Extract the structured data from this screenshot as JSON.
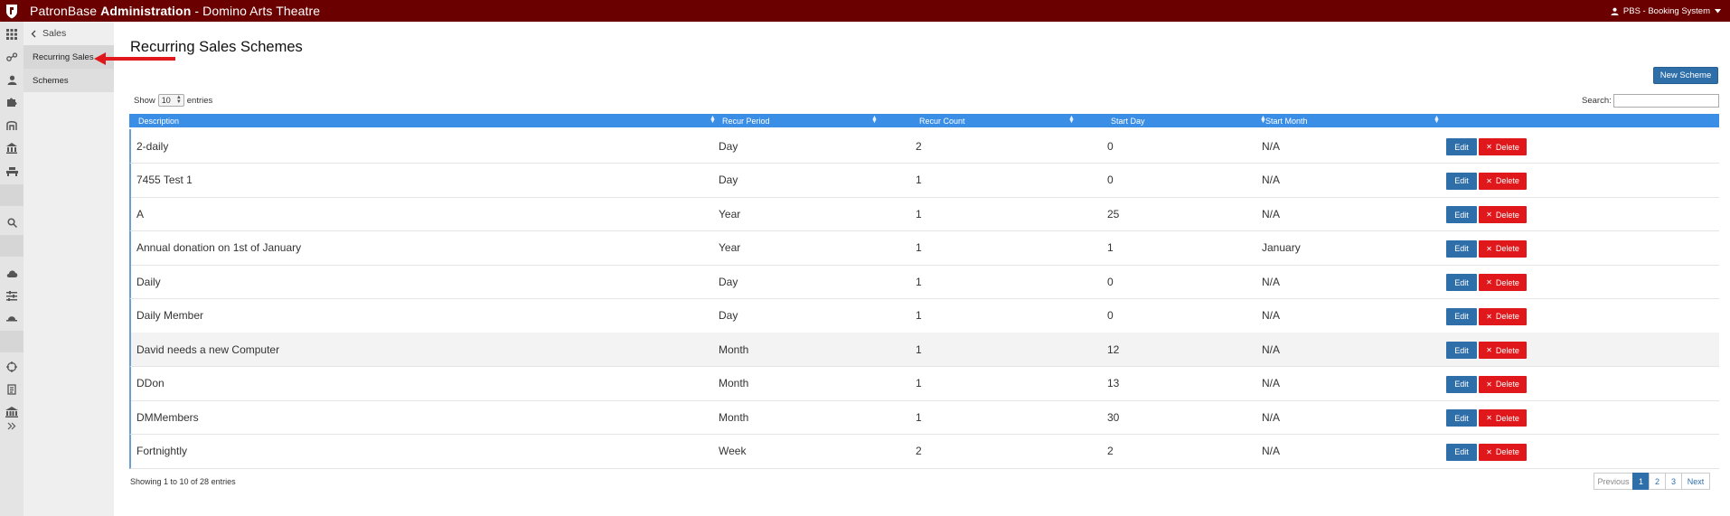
{
  "header": {
    "app_name": "PatronBase",
    "section": "Administration",
    "separator": "-",
    "venue": "Domino Arts Theatre",
    "user_label": "PBS - Booking System"
  },
  "submenu": {
    "back_label": "Sales",
    "items": [
      {
        "label": "Recurring Sales"
      },
      {
        "label": "Schemes"
      }
    ]
  },
  "page": {
    "title": "Recurring Sales Schemes",
    "new_button": "New Scheme",
    "show_prefix": "Show",
    "show_value": "10",
    "show_suffix": "entries",
    "search_label": "Search:",
    "search_value": ""
  },
  "table": {
    "columns": [
      "Description",
      "Recur Period",
      "Recur Count",
      "Start Day",
      "Start Month"
    ],
    "edit_label": "Edit",
    "delete_label": "Delete",
    "rows": [
      {
        "description": "2-daily",
        "period": "Day",
        "count": "2",
        "start_day": "0",
        "start_month": "N/A"
      },
      {
        "description": "7455 Test 1",
        "period": "Day",
        "count": "1",
        "start_day": "0",
        "start_month": "N/A"
      },
      {
        "description": "A",
        "period": "Year",
        "count": "1",
        "start_day": "25",
        "start_month": "N/A"
      },
      {
        "description": "Annual donation on 1st of January",
        "period": "Year",
        "count": "1",
        "start_day": "1",
        "start_month": "January"
      },
      {
        "description": "Daily",
        "period": "Day",
        "count": "1",
        "start_day": "0",
        "start_month": "N/A"
      },
      {
        "description": "Daily Member",
        "period": "Day",
        "count": "1",
        "start_day": "0",
        "start_month": "N/A"
      },
      {
        "description": "David needs a new Computer",
        "period": "Month",
        "count": "1",
        "start_day": "12",
        "start_month": "N/A"
      },
      {
        "description": "DDon",
        "period": "Month",
        "count": "1",
        "start_day": "13",
        "start_month": "N/A"
      },
      {
        "description": "DMMembers",
        "period": "Month",
        "count": "1",
        "start_day": "30",
        "start_month": "N/A"
      },
      {
        "description": "Fortnightly",
        "period": "Week",
        "count": "2",
        "start_day": "2",
        "start_month": "N/A"
      }
    ]
  },
  "footer": {
    "info": "Showing 1 to 10 of 28 entries",
    "pagination": [
      "Previous",
      "1",
      "2",
      "3",
      "Next"
    ],
    "current_page": "1"
  },
  "colors": {
    "topbar": "#6b0000",
    "header_row": "#3a8ee6",
    "edit": "#2f6fa9",
    "delete": "#e0171b",
    "arrow": "#e0171b"
  }
}
